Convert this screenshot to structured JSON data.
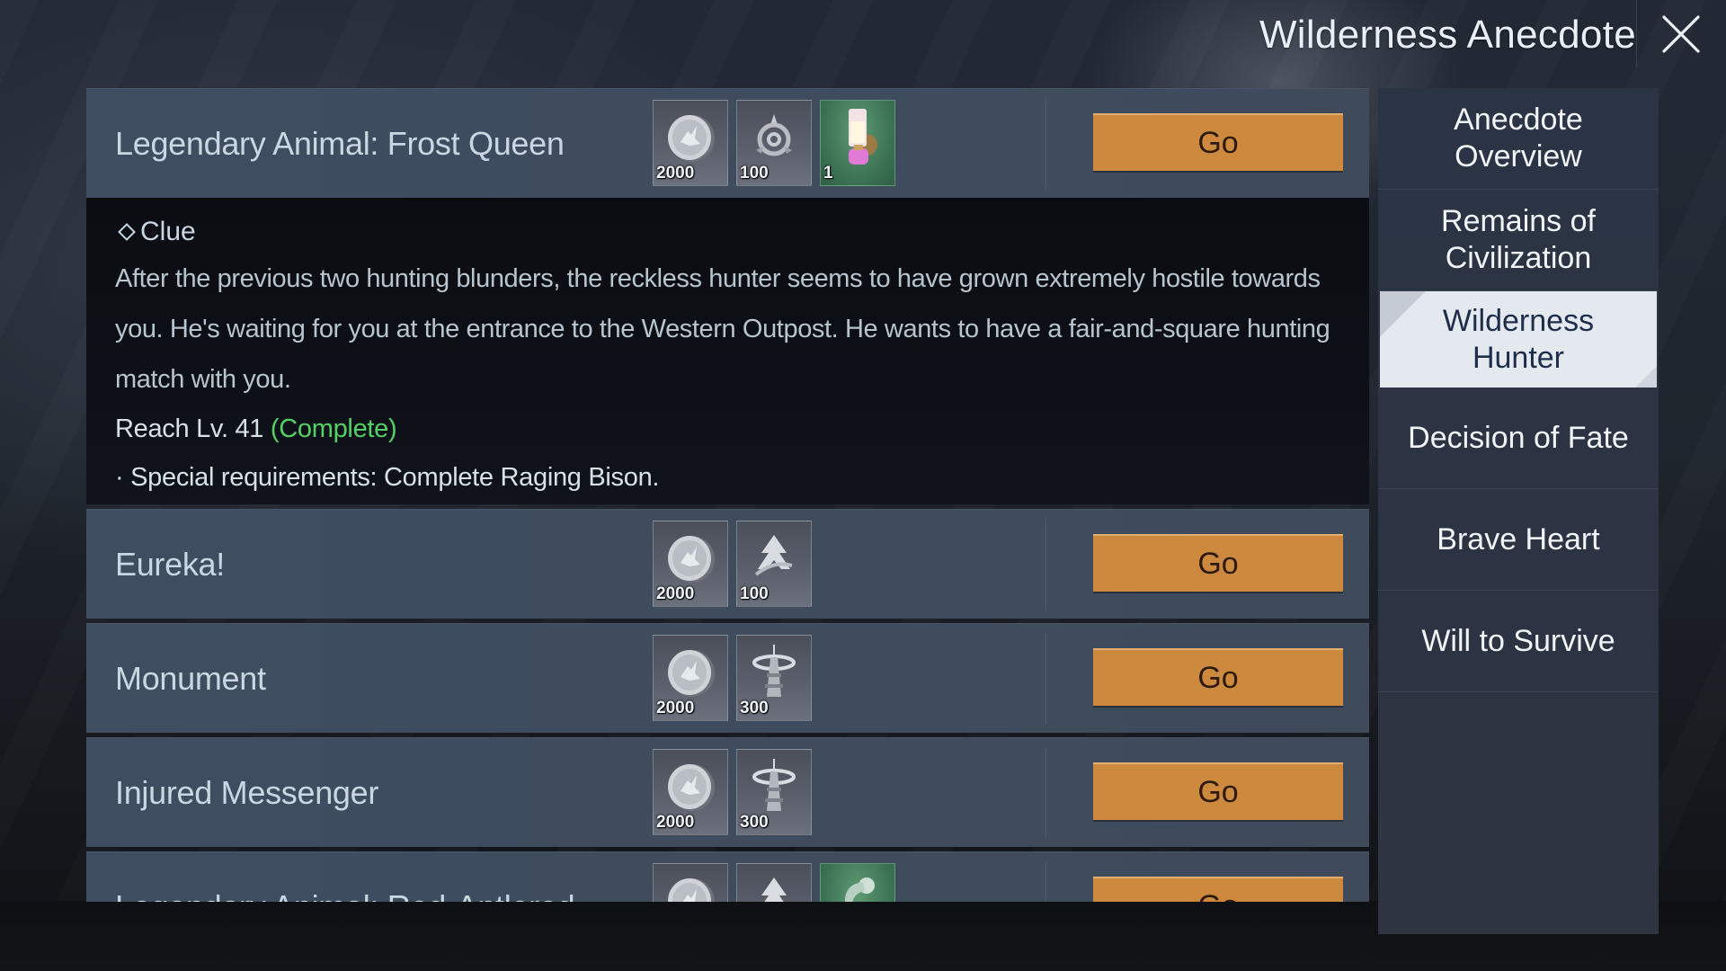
{
  "header": {
    "title": "Wilderness Anecdote",
    "close_icon": "close-x-icon"
  },
  "sidebar": {
    "items": [
      {
        "label": "Anecdote\nOverview",
        "active": false
      },
      {
        "label": "Remains of\nCivilization",
        "active": false
      },
      {
        "label": "Wilderness\nHunter",
        "active": true
      },
      {
        "label": "Decision of Fate",
        "active": false
      },
      {
        "label": "Brave Heart",
        "active": false
      },
      {
        "label": "Will to Survive",
        "active": false
      }
    ]
  },
  "quests": [
    {
      "name": "Legendary Animal: Frost Queen",
      "go_label": "Go",
      "rewards": [
        {
          "icon": "silver-eagle-coin-icon",
          "count": "2000"
        },
        {
          "icon": "target-emblem-icon",
          "count": "100"
        },
        {
          "icon": "pink-lamp-item-icon",
          "count": "1",
          "rarity": "green"
        }
      ],
      "expanded": true,
      "clue": {
        "heading": "Clue",
        "text": "After the previous two hunting blunders, the reckless hunter seems to have grown extremely hostile towards you. He's waiting for you at the entrance to the Western Outpost. He wants to have a fair-and-square hunting match with you.",
        "requirement_level": "Reach Lv. 41",
        "requirement_status": "(Complete)",
        "special_requirement": "· Special requirements:  Complete Raging Bison."
      }
    },
    {
      "name": "Eureka!",
      "go_label": "Go",
      "rewards": [
        {
          "icon": "silver-eagle-coin-icon",
          "count": "2000"
        },
        {
          "icon": "arrow-tree-emblem-icon",
          "count": "100"
        }
      ]
    },
    {
      "name": "Monument",
      "go_label": "Go",
      "rewards": [
        {
          "icon": "silver-eagle-coin-icon",
          "count": "2000"
        },
        {
          "icon": "radio-tower-icon",
          "count": "300"
        }
      ]
    },
    {
      "name": "Injured Messenger",
      "go_label": "Go",
      "rewards": [
        {
          "icon": "silver-eagle-coin-icon",
          "count": "2000"
        },
        {
          "icon": "radio-tower-icon",
          "count": "300"
        }
      ]
    },
    {
      "name": "Legendary Animal: Red-Antlered",
      "go_label": "Go",
      "rewards": [
        {
          "icon": "silver-eagle-coin-icon",
          "count": ""
        },
        {
          "icon": "arrow-tree-emblem-icon",
          "count": ""
        },
        {
          "icon": "faucet-item-icon",
          "count": "",
          "rarity": "green"
        }
      ]
    }
  ],
  "colors": {
    "go_button": "#cd8a3f",
    "complete_green": "#52d264",
    "active_tab_bg": "#e4e9f0",
    "active_tab_text": "#1d2d4a"
  }
}
